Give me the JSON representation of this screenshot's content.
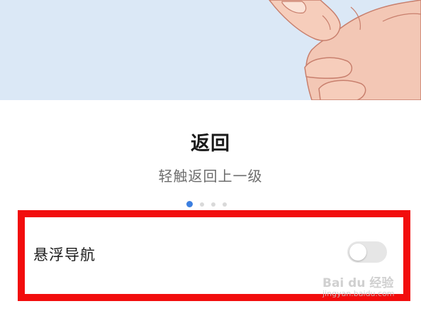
{
  "illustration": {
    "icon": "finger-tap-illustration",
    "background_color": "#dbe8f6"
  },
  "gesture": {
    "title": "返回",
    "description": "轻触返回上一级"
  },
  "pager": {
    "total": 4,
    "active_index": 0,
    "active_color": "#3c7fe0"
  },
  "setting": {
    "label": "悬浮导航",
    "enabled": false
  },
  "annotation": {
    "highlight_color": "#f20d0d"
  },
  "watermark": {
    "logo": "Bai du 经验",
    "url": "jingyan.baidu.com"
  }
}
